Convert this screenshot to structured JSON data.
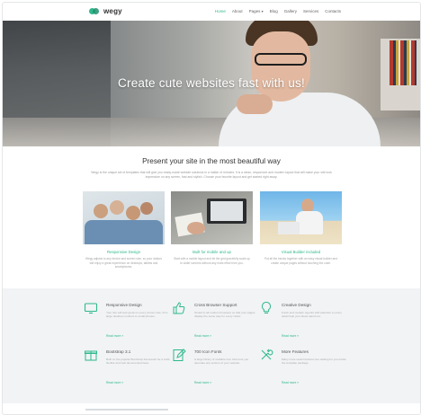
{
  "header": {
    "brand": "wegy",
    "nav": [
      {
        "label": "Home",
        "active": true,
        "has_caret": false
      },
      {
        "label": "About",
        "active": false,
        "has_caret": false
      },
      {
        "label": "Pages",
        "active": false,
        "has_caret": true
      },
      {
        "label": "Blog",
        "active": false,
        "has_caret": false
      },
      {
        "label": "Gallery",
        "active": false,
        "has_caret": false
      },
      {
        "label": "Services",
        "active": false,
        "has_caret": false
      },
      {
        "label": "Contacts",
        "active": false,
        "has_caret": false
      }
    ],
    "caret_glyph": "▾"
  },
  "hero": {
    "title": "Create cute websites fast with us!"
  },
  "intro": {
    "title": "Present your site in the most beautiful way",
    "text": "Wegy is the unique set of templates that will give you ready-made website solutions in a matter of minutes. It is a clean, responsive and modern layout that will make your site look impressive on any screen, fast and stylish. Choose your favorite layout and get started right away."
  },
  "cards": [
    {
      "title": "Responsive Design",
      "text": "Wegy adjusts to any device and screen size, so your visitors will enjoy a great experience on desktops, tablets and smartphones."
    },
    {
      "title": "Built for mobile and up",
      "text": "Start with a mobile layout and let the grid gracefully scale up to wider screens without any extra effort from you."
    },
    {
      "title": "Visual Builder included",
      "text": "Put all the blocks together with an easy visual builder and create unique pages without touching the code."
    }
  ],
  "features": [
    {
      "icon": "monitor-icon",
      "title": "Responsive Design",
      "text": "Your site will look great on every screen size, from large desktop monitors to small phones.",
      "more": "Read more »"
    },
    {
      "icon": "thumbs-up-icon",
      "title": "Cross Browser Support",
      "text": "Tested in all modern browsers so that your pages display the same way for every visitor.",
      "more": "Read more »"
    },
    {
      "icon": "lightbulb-icon",
      "title": "Creative Design",
      "text": "Fresh and modern layouts with attention to every detail help your ideas stand out.",
      "more": "Read more »"
    },
    {
      "icon": "gift-icon",
      "title": "Bootstrap 3.1",
      "text": "Built on the popular Bootstrap framework for a solid, flexible and well documented base.",
      "more": "Read more »"
    },
    {
      "icon": "edit-icon",
      "title": "700 Icon Fonts",
      "text": "A large library of scalable icon fonts lets you decorate any section of your website.",
      "more": "Read more »"
    },
    {
      "icon": "tools-icon",
      "title": "More Features",
      "text": "Many more useful features are waiting for you inside the template package.",
      "more": "Read more »"
    }
  ],
  "colors": {
    "accent": "#2fb88c",
    "features_bg": "#f1f3f5"
  }
}
